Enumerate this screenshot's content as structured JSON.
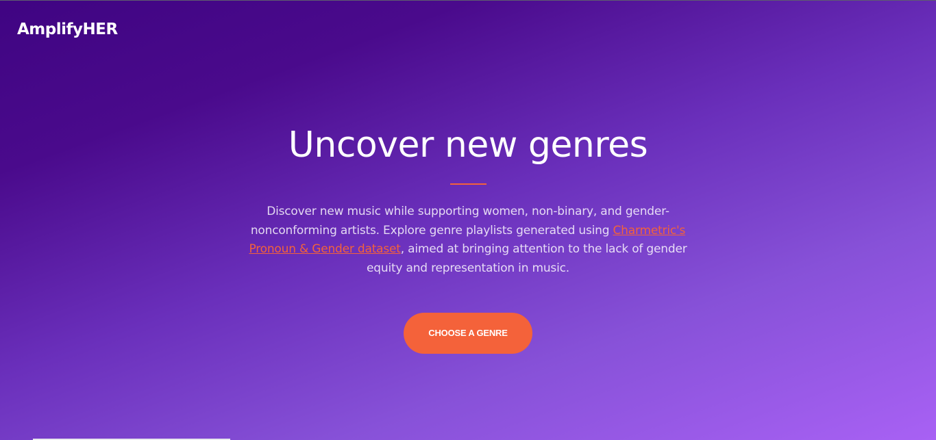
{
  "brand": {
    "name": "AmplifyHER"
  },
  "hero": {
    "title": "Uncover new genres",
    "text_before_link": "Discover new music while supporting women, non-binary, and gender-nonconforming artists. Explore genre playlists generated using ",
    "link_text": "Charmetric's Pronoun & Gender dataset",
    "text_after_link": ", aimed at bringing attention to the lack of gender equity and representation in music.",
    "cta_label": "Choose a genre"
  },
  "colors": {
    "accent": "#f4623a",
    "gradient_start": "#3f0482",
    "gradient_end": "#a861f4"
  }
}
